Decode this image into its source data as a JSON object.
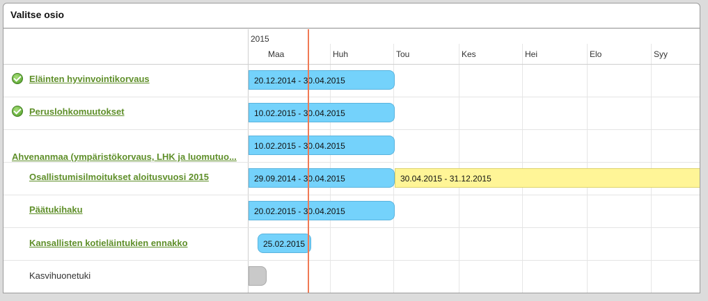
{
  "panel": {
    "title": "Valitse osio"
  },
  "timeline": {
    "year": "2015",
    "months": [
      "Maa",
      "Huh",
      "Tou",
      "Kes",
      "Hei",
      "Elo",
      "Syy"
    ]
  },
  "rows": [
    {
      "label": "Eläinten hyvinvointikorvaus",
      "status": "completed",
      "bars": [
        {
          "text": "20.12.2014 - 30.04.2015",
          "color": "#74d2fb"
        }
      ]
    },
    {
      "label": "Peruslohkomuutokset",
      "status": "completed",
      "bars": [
        {
          "text": "10.02.2015 - 30.04.2015",
          "color": "#74d2fb"
        }
      ]
    },
    {
      "label": "Ahvenanmaa (ympäristökorvaus, LHK ja luomutuo...",
      "bars": [
        {
          "text": "10.02.2015 - 30.04.2015",
          "color": "#74d2fb"
        }
      ]
    },
    {
      "label": "Osallistumisilmoitukset aloitusvuosi 2015",
      "bars": [
        {
          "text": "29.09.2014 - 30.04.2015",
          "color": "#74d2fb"
        },
        {
          "text": "30.04.2015 - 31.12.2015",
          "color": "#fff597"
        }
      ]
    },
    {
      "label": "Päätukihaku",
      "bars": [
        {
          "text": "20.02.2015 - 30.04.2015",
          "color": "#74d2fb"
        }
      ]
    },
    {
      "label": "Kansallisten kotieläintukien ennakko",
      "bars": [
        {
          "text": "25.02.2015",
          "color": "#74d2fb"
        }
      ]
    },
    {
      "label": "Kasvihuonetuki",
      "bars": [
        {
          "text": "",
          "color": "#c9c9c9"
        }
      ]
    }
  ]
}
